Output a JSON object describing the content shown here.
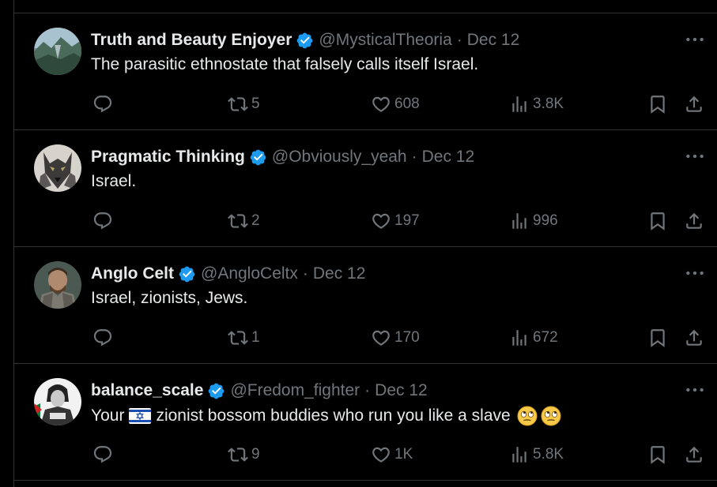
{
  "colors": {
    "background": "#000000",
    "text_primary": "#e7e9ea",
    "text_secondary": "#71767b",
    "verified_badge": "#1d9bf0",
    "divider": "#2f3336"
  },
  "posts": [
    {
      "display_name": "Truth and Beauty Enjoyer",
      "handle": "@MysticalTheoria",
      "separator": "·",
      "date": "Dec 12",
      "text": "The parasitic ethnostate that falsely calls itself Israel.",
      "retweets": "5",
      "likes": "608",
      "views": "3.8K",
      "avatar_icon": "landscape-avatar"
    },
    {
      "display_name": "Pragmatic Thinking",
      "handle": "@Obviously_yeah",
      "separator": "·",
      "date": "Dec 12",
      "text": "Israel.",
      "retweets": "2",
      "likes": "197",
      "views": "996",
      "avatar_icon": "wolf-avatar"
    },
    {
      "display_name": "Anglo Celt",
      "handle": "@AngloCeltx",
      "separator": "·",
      "date": "Dec 12",
      "text": "Israel, zionists, Jews.",
      "retweets": "1",
      "likes": "170",
      "views": "672",
      "avatar_icon": "warrior-avatar"
    },
    {
      "display_name": "balance_scale",
      "handle": "@Fredom_fighter",
      "separator": "·",
      "date": "Dec 12",
      "text_before": "Your",
      "flag_icon": "israel-flag-emoji",
      "text_after": "zionist bossom buddies who run you like a slave",
      "emojis": [
        "face-with-rolling-eyes-emoji",
        "face-with-rolling-eyes-emoji"
      ],
      "retweets": "9",
      "likes": "1K",
      "views": "5.8K",
      "avatar_icon": "portrait-avatar"
    }
  ]
}
